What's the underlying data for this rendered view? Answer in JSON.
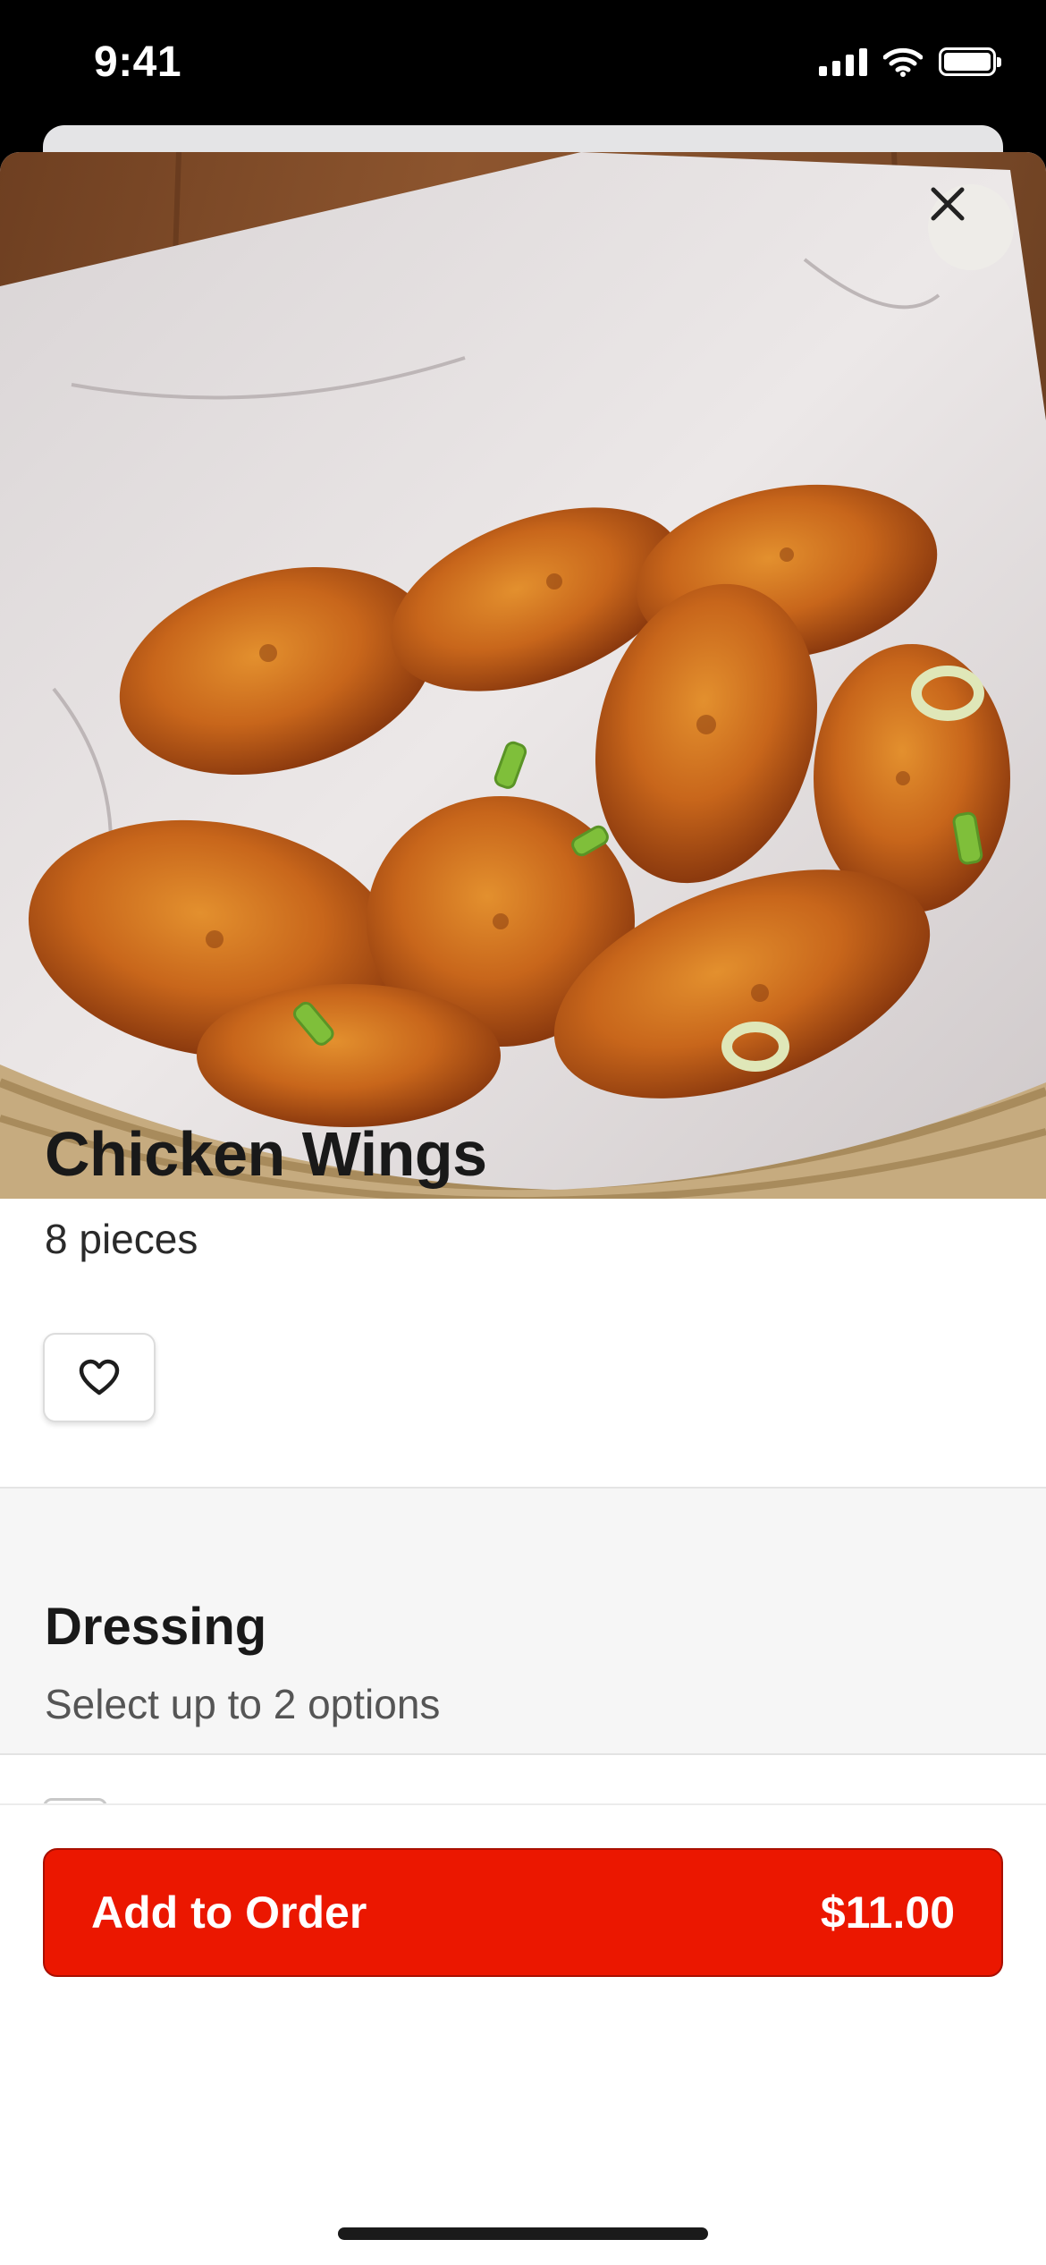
{
  "status_bar": {
    "time": "9:41"
  },
  "item": {
    "title": "Chicken Wings",
    "subtitle": "8 pieces"
  },
  "section": {
    "title": "Dressing",
    "subtitle": "Select up to 2 options"
  },
  "footer": {
    "button_label": "Add to Order",
    "price": "$11.00"
  },
  "colors": {
    "accent": "#eb1700",
    "text": "#191919",
    "section_bg": "#f6f6f6"
  },
  "icons": {
    "close": "close-icon",
    "favorite": "heart-icon"
  }
}
